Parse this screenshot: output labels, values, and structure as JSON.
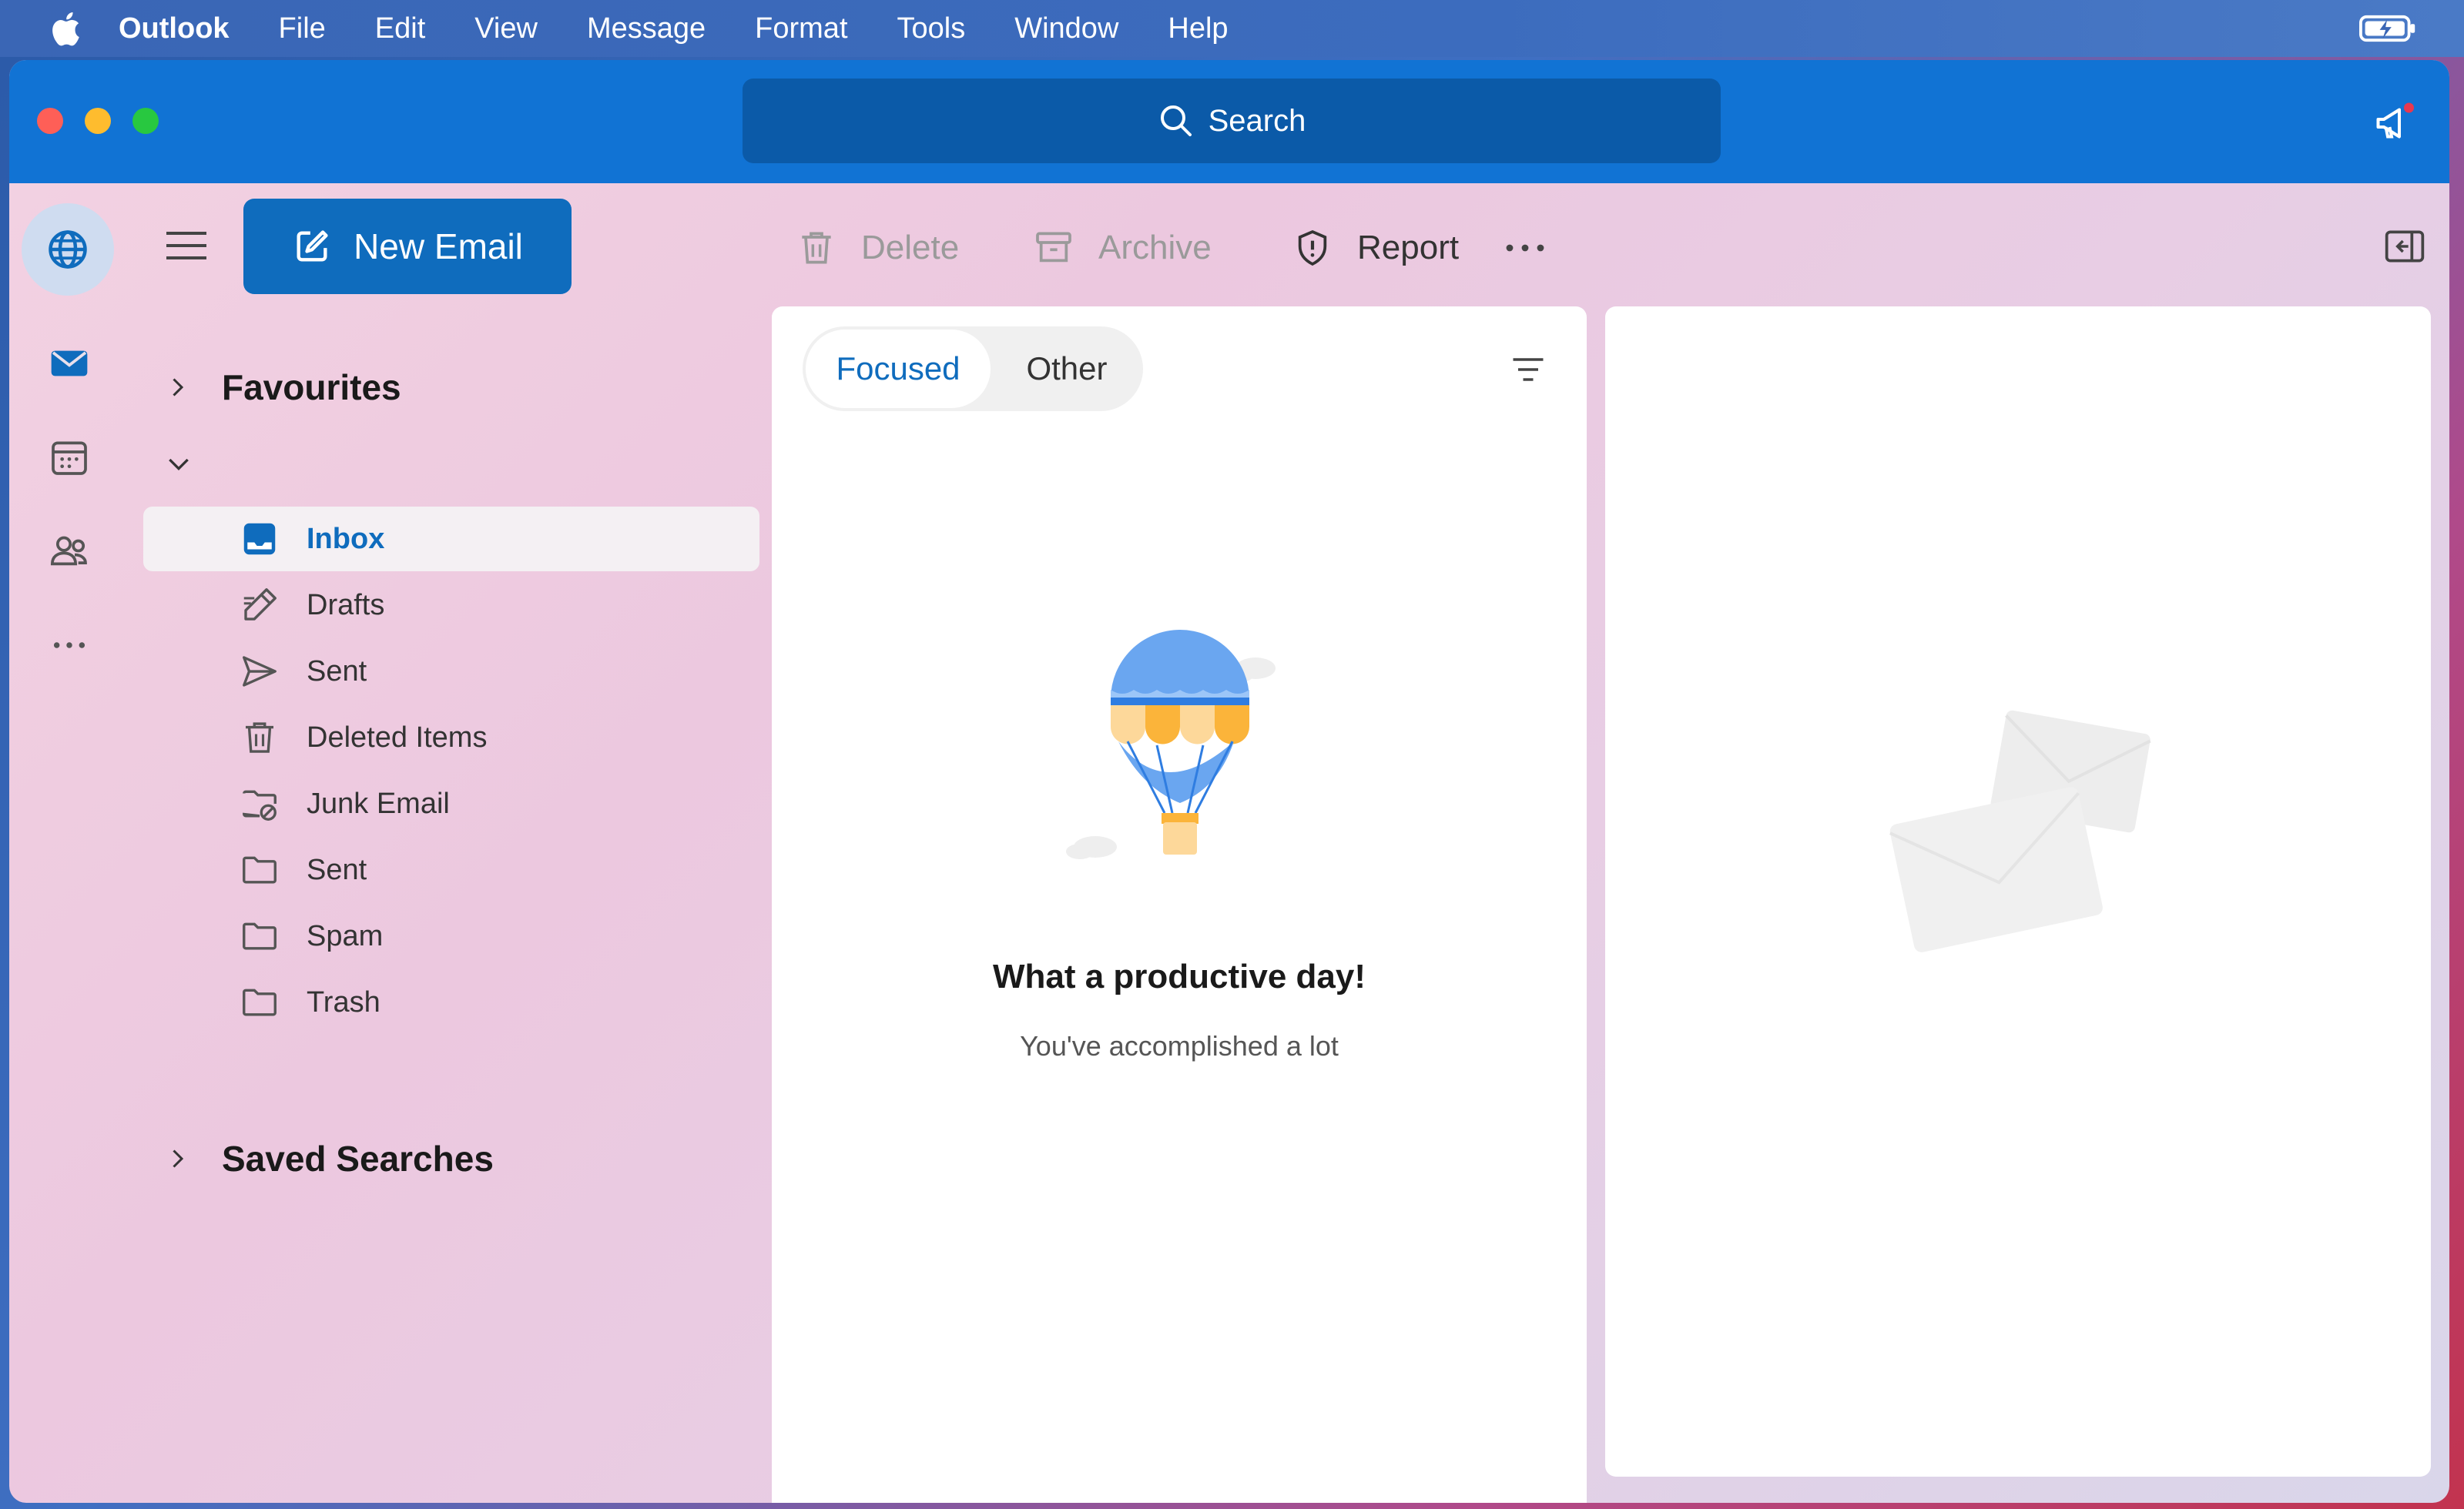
{
  "menubar": {
    "app": "Outlook",
    "items": [
      "File",
      "Edit",
      "View",
      "Message",
      "Format",
      "Tools",
      "Window",
      "Help"
    ]
  },
  "titlebar": {
    "search_label": "Search"
  },
  "toolbar": {
    "new_email": "New Email",
    "delete": "Delete",
    "archive": "Archive",
    "report": "Report"
  },
  "nav": {
    "favourites": "Favourites",
    "saved_searches": "Saved Searches",
    "folders": [
      {
        "label": "Inbox",
        "icon": "inbox-icon"
      },
      {
        "label": "Drafts",
        "icon": "pencil-icon"
      },
      {
        "label": "Sent",
        "icon": "send-icon"
      },
      {
        "label": "Deleted Items",
        "icon": "trash-icon"
      },
      {
        "label": "Junk Email",
        "icon": "junk-folder-icon"
      },
      {
        "label": "Sent",
        "icon": "folder-icon"
      },
      {
        "label": "Spam",
        "icon": "folder-icon"
      },
      {
        "label": "Trash",
        "icon": "folder-icon"
      }
    ]
  },
  "list": {
    "tab_focused": "Focused",
    "tab_other": "Other",
    "empty_title": "What a productive day!",
    "empty_subtitle": "You've accomplished a lot"
  },
  "colors": {
    "accent": "#0f6cbd",
    "titlebar": "#1173d4"
  }
}
